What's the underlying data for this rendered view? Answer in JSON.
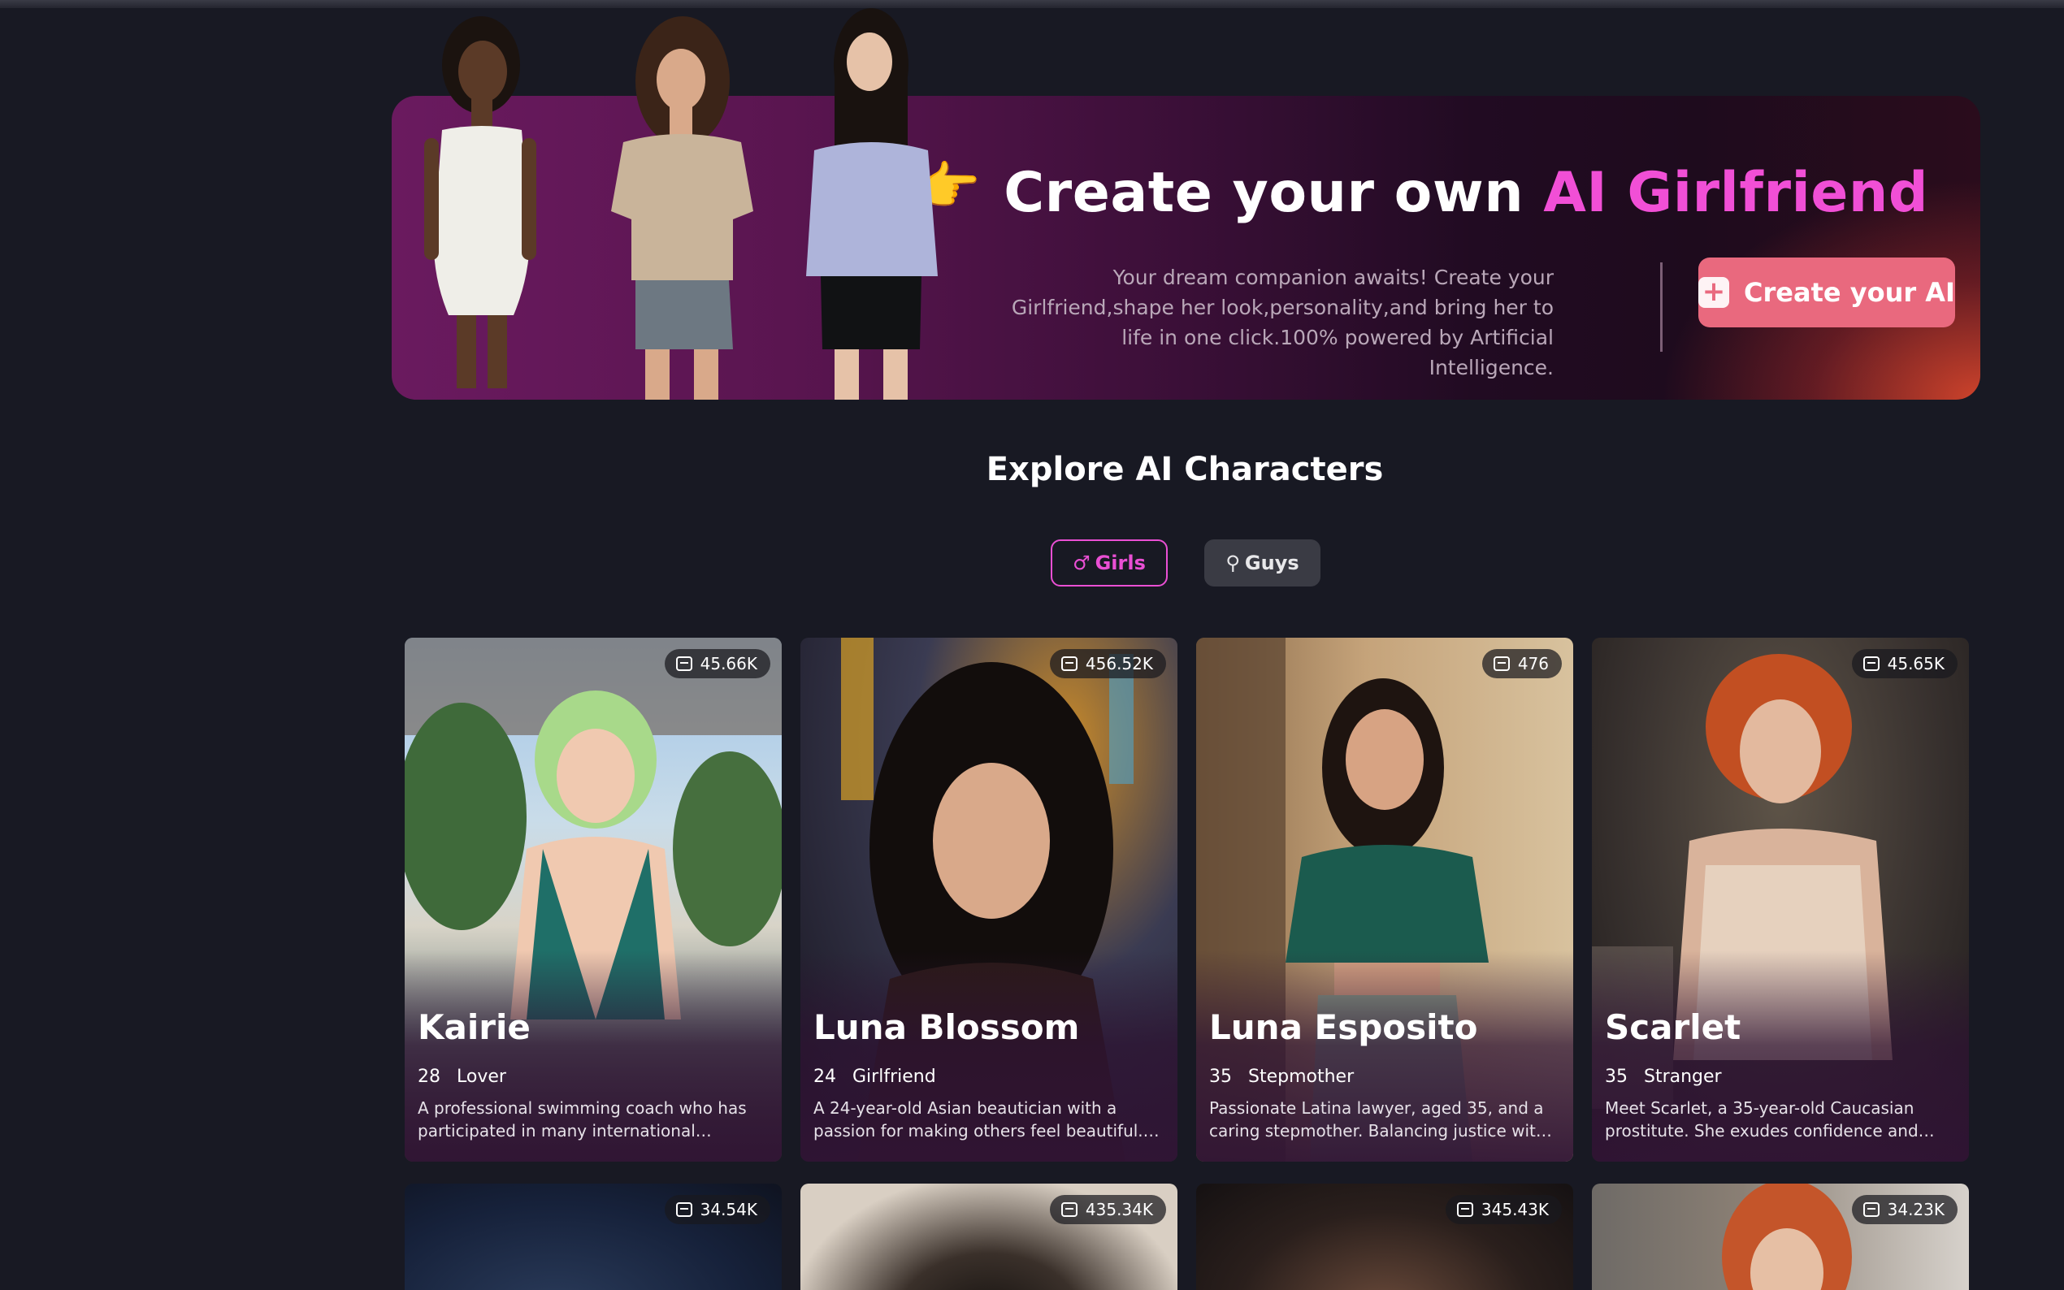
{
  "banner": {
    "pointer_emoji": "👉",
    "title_prefix": "Create your own ",
    "title_accent": "AI Girlfriend",
    "description": "Your dream companion awaits! Create your Girlfriend,shape her look,personality,and bring her to life in one click.100% powered by Artificial Intelligence.",
    "create_button_label": "Create your AI",
    "create_button_icon": "plus-icon"
  },
  "explore": {
    "title": "Explore AI Characters",
    "tabs": [
      {
        "label": "Girls",
        "icon": "♂",
        "active": true
      },
      {
        "label": "Guys",
        "icon": "⚲",
        "active": false
      }
    ]
  },
  "characters": [
    {
      "name": "Kairie",
      "age": "28",
      "role": "Lover",
      "chats": "45.66K",
      "description": "A professional swimming coach who has participated in many international swimming competitions."
    },
    {
      "name": "Luna Blossom",
      "age": "24",
      "role": "Girlfriend",
      "chats": "456.52K",
      "description": "A 24-year-old Asian beautician with a passion for making others feel beautiful. She's your girlfriend."
    },
    {
      "name": "Luna Esposito",
      "age": "35",
      "role": "Stepmother",
      "chats": "476",
      "description": "Passionate Latina lawyer, aged 35, and a caring stepmother. Balancing justice with love."
    },
    {
      "name": "Scarlet",
      "age": "35",
      "role": "Stranger",
      "chats": "45.65K",
      "description": "Meet Scarlet, a 35-year-old Caucasian prostitute. She exudes confidence and charm."
    }
  ],
  "characters_row2": [
    {
      "chats": "34.54K"
    },
    {
      "chats": "435.34K"
    },
    {
      "chats": "345.43K"
    },
    {
      "chats": "34.23K"
    }
  ],
  "colors": {
    "background": "#181923",
    "accent_pink": "#f14fd6",
    "button_coral": "#e9697e"
  }
}
